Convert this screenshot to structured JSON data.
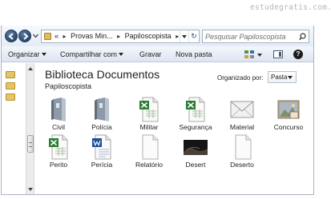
{
  "watermark": "estudegratis.com.br",
  "address": {
    "crumbs": [
      "«",
      "Provas Min...",
      "Papiloscopista"
    ],
    "search_placeholder": "Pesquisar Papiloscopista"
  },
  "commands": {
    "organize": "Organizar",
    "share": "Compartilhar com",
    "burn": "Gravar",
    "new_folder": "Nova pasta"
  },
  "library": {
    "title": "Biblioteca Documentos",
    "subtitle": "Papiloscopista",
    "arrange_label": "Organizado por:",
    "arrange_value": "Pasta"
  },
  "files": [
    {
      "label": "Civil",
      "icon": "binder-folder-icon"
    },
    {
      "label": "Polícia",
      "icon": "binder-folder-icon"
    },
    {
      "label": "Militar",
      "icon": "excel-file-icon"
    },
    {
      "label": "Segurança",
      "icon": "excel-file-icon"
    },
    {
      "label": "Material",
      "icon": "envelope-icon"
    },
    {
      "label": "Concurso",
      "icon": "image-file-icon"
    },
    {
      "label": "Perito",
      "icon": "excel-file-icon"
    },
    {
      "label": "Perícia",
      "icon": "word-file-icon"
    },
    {
      "label": "Relatório",
      "icon": "blank-file-icon"
    },
    {
      "label": "Desert",
      "icon": "image-thumbnail-icon"
    },
    {
      "label": "Deserto",
      "icon": "blank-file-icon"
    }
  ]
}
